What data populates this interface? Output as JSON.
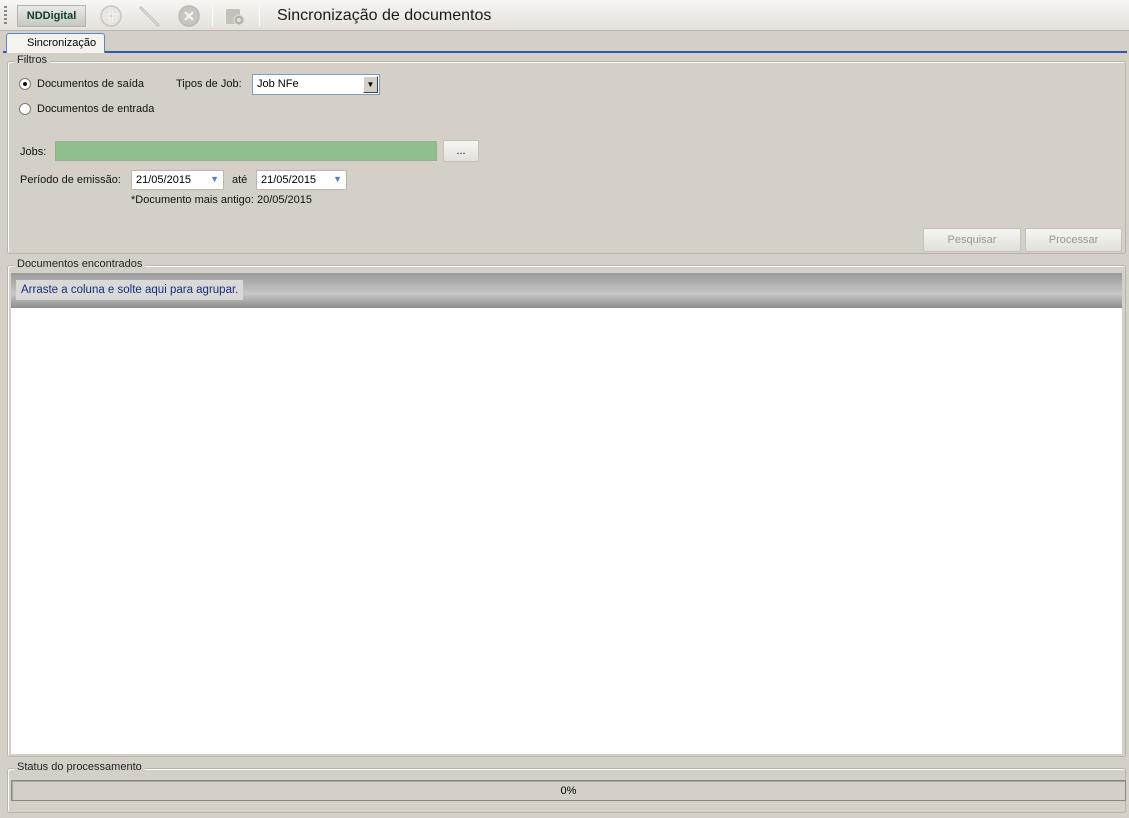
{
  "toolbar": {
    "brand": "NDDigital",
    "icons": [
      "add-icon",
      "edit-icon",
      "delete-icon",
      "settings-icon"
    ],
    "title": "Sincronização de documentos"
  },
  "tabs": [
    {
      "label": "Sincronização",
      "active": true
    }
  ],
  "filters": {
    "legend": "Filtros",
    "radio_saida": "Documentos de saída",
    "radio_entrada": "Documentos de entrada",
    "selected": "saida",
    "job_type_label": "Tipos de Job:",
    "job_type_value": "Job NFe",
    "jobs_label": "Jobs:",
    "jobs_value": "",
    "browse_label": "...",
    "period_label": "Período de emissão:",
    "date_from": "21/05/2015",
    "ate_label": "até",
    "date_to": "21/05/2015",
    "oldest_note": "*Documento mais antigo: 20/05/2015",
    "search_label": "Pesquisar",
    "process_label": "Processar"
  },
  "results": {
    "legend": "Documentos encontrados",
    "group_drop_hint": "Arraste a coluna e solte aqui para agrupar.",
    "rows": []
  },
  "status": {
    "legend": "Status do processamento",
    "progress_text": "0%",
    "progress": 0
  },
  "colors": {
    "tab_border": "#2f5aa8",
    "jobs_field": "#8fbf8c",
    "hint_text": "#1a2f7a"
  }
}
